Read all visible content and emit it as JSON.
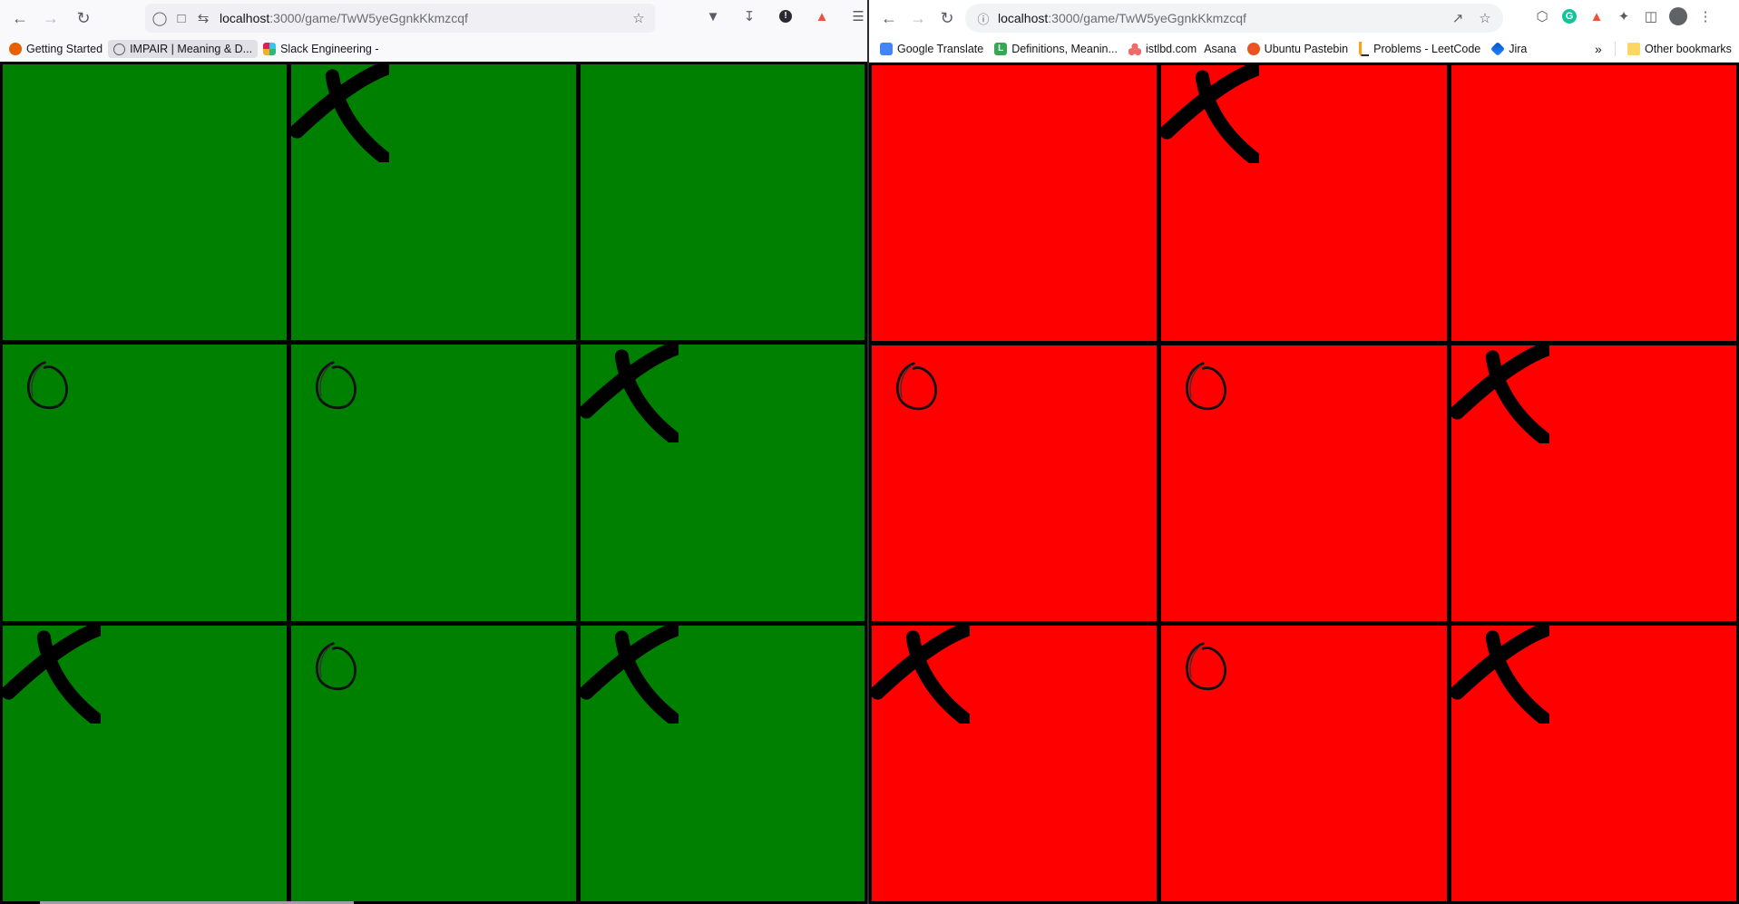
{
  "colors": {
    "left_board": "#008000",
    "right_board": "#ff0000",
    "grid": "#000000"
  },
  "firefox": {
    "url_host": "localhost",
    "url_path": ":3000/game/TwW5yeGgnkKkmzcqf",
    "icons": [
      "back-icon",
      "forward-icon",
      "reload-icon",
      "shield-icon",
      "page-icon",
      "permissions-icon",
      "star-icon",
      "pocket-icon",
      "download-icon",
      "extension-icon",
      "extension-icon",
      "menu-icon"
    ],
    "bookmarks": [
      {
        "label": "Getting Started",
        "icon": "firefox-icon",
        "color": "#e66000"
      },
      {
        "label": "IMPAIR | Meaning & D...",
        "icon": "globe-icon",
        "color": "#5b5b66"
      },
      {
        "label": "Slack Engineering -",
        "icon": "slack-icon",
        "color": "#4a154b"
      }
    ]
  },
  "chrome": {
    "url_host": "localhost",
    "url_path": ":3000/game/TwW5yeGgnkKkmzcqf",
    "bookmarks": [
      {
        "label": "Google Translate",
        "icon": "translate-icon",
        "color": "#4285f4"
      },
      {
        "label": "Definitions, Meanin...",
        "icon": "l-icon",
        "color": "#34a853"
      },
      {
        "label": "istlbd.com",
        "icon": "asana-icon",
        "color": "#f06a6a"
      },
      {
        "label": "Asana",
        "icon": "",
        "color": ""
      },
      {
        "label": "Ubuntu Pastebin",
        "icon": "ubuntu-icon",
        "color": "#e95420"
      },
      {
        "label": "Problems - LeetCode",
        "icon": "leetcode-icon",
        "color": "#ffa116"
      },
      {
        "label": "Jira",
        "icon": "jira-icon",
        "color": "#2684ff"
      }
    ],
    "more": "»",
    "other_bookmarks": "Other bookmarks"
  },
  "board": [
    "",
    "X",
    "",
    "O",
    "O",
    "X",
    "X",
    "O",
    "X"
  ]
}
